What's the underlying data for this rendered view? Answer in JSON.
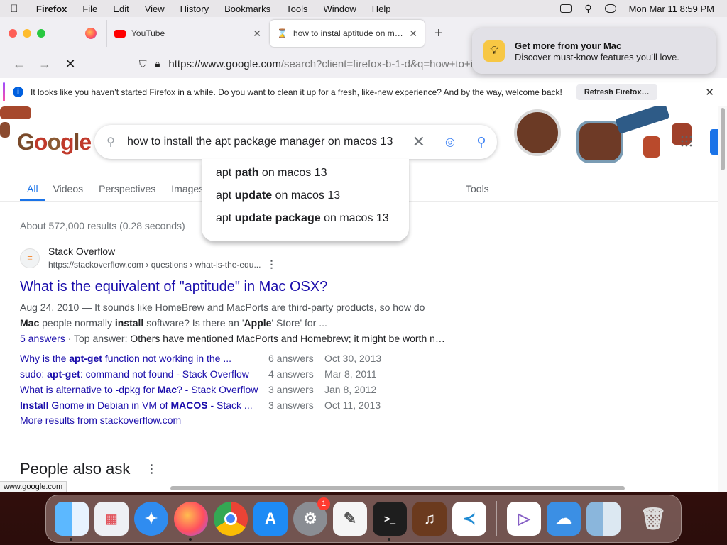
{
  "menubar": {
    "apple_icon": "",
    "app_name": "Firefox",
    "menus": [
      "File",
      "Edit",
      "View",
      "History",
      "Bookmarks",
      "Tools",
      "Window",
      "Help"
    ],
    "datetime": "Mon Mar 11  8:59 PM"
  },
  "browser": {
    "tabs": [
      {
        "title": "",
        "icon": "firefox-icon"
      },
      {
        "title": "YouTube",
        "icon": "youtube-icon"
      },
      {
        "title": "how to instal aptitude on macos",
        "icon": "hourglass-icon",
        "active": true
      }
    ],
    "url_host": "https://www.google.com",
    "url_rest": "/search?client=firefox-b-1-d&q=how+to+i",
    "infobar_text": "It looks like you haven’t started Firefox in a while. Do you want to clean it up for a fresh, like-new experience? And by the way, welcome back!",
    "infobar_button": "Refresh Firefox…",
    "status_url": "www.google.com"
  },
  "notification": {
    "title": "Get more from your Mac",
    "body": "Discover must-know features you’ll love."
  },
  "google": {
    "search_query": "how to install the apt package manager on macos 13",
    "suggestions": [
      {
        "prefix": "apt ",
        "bold": "path",
        "suffix": " on macos 13"
      },
      {
        "prefix": "apt ",
        "bold": "update",
        "suffix": " on macos 13"
      },
      {
        "prefix": "apt ",
        "bold": "update package",
        "suffix": " on macos 13"
      }
    ],
    "tabs": [
      "All",
      "Videos",
      "Perspectives",
      "Images"
    ],
    "tools": "Tools",
    "result_stats": "About 572,000 results (0.28 seconds)",
    "result": {
      "site_name": "Stack Overflow",
      "site_url": "https://stackoverflow.com › questions › what-is-the-equ...",
      "title": "What is the equivalent of \"aptitude\" in Mac OSX?",
      "snippet_date": "Aug 24, 2010",
      "snippet_line1": " — It sounds like HomeBrew and MacPorts are third-party products, so how do",
      "snippet_b1": "Mac",
      "snippet_mid1": " people normally ",
      "snippet_b2": "install",
      "snippet_mid2": " software? Is there an '",
      "snippet_b3": "Apple",
      "snippet_end": "' Store' for ...",
      "answers_link": "5 answers",
      "top_answer_label": " · Top answer: ",
      "top_answer": "Others have mentioned MacPorts and Homebrew; it might be worth n…",
      "sitelinks": [
        {
          "pre": "Why is the ",
          "bold": "apt-get",
          "post": " function not working in the ...",
          "answers": "6 answers",
          "date": "Oct 30, 2013"
        },
        {
          "pre": "sudo: ",
          "bold": "apt-get",
          "post": ": command not found - Stack Overflow",
          "answers": "4 answers",
          "date": "Mar 8, 2011"
        },
        {
          "pre": "What is alternative to -dpkg for ",
          "bold": "Mac",
          "post": "? - Stack Overflow",
          "answers": "3 answers",
          "date": "Jan 8, 2012"
        },
        {
          "pre": "",
          "bold": "Install",
          "post": " Gnome in Debian in VM of ",
          "bold2": "MACOS",
          "post2": " - Stack ...",
          "answers": "3 answers",
          "date": "Oct 11, 2013"
        }
      ],
      "more_results": "More results from stackoverflow.com"
    },
    "people_also_ask": "People also ask"
  },
  "dock": {
    "apps": [
      "finder-icon",
      "launchpad-icon",
      "safari-icon",
      "firefox-icon",
      "chrome-icon",
      "app-store-icon",
      "system-settings-icon",
      "textedit-icon",
      "terminal-icon",
      "garageband-icon",
      "vscode-icon",
      "visual-studio-icon",
      "weather-icon",
      "finder-alt-icon",
      "trash-icon"
    ],
    "badge_count": "1"
  },
  "colors": {
    "link": "#1a0dab",
    "accent": "#1a73e8",
    "menubar_bg": "#e8e6e9"
  }
}
